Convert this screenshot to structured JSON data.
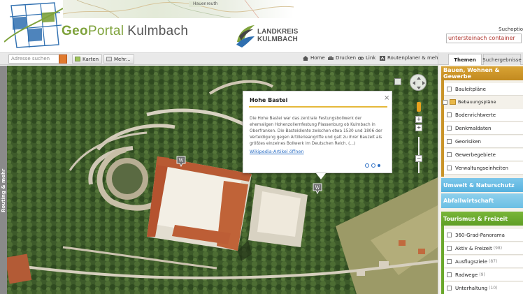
{
  "header": {
    "brand_geo": "Geo",
    "brand_portal": "Portal",
    "brand_place": "Kulmbach",
    "landkreis_line1": "LANDKREIS",
    "landkreis_line2": "KULMBACH",
    "search_options_label": "Suchoptio",
    "search_value": "untersteinach container",
    "map_place_label": "Hauenreuth"
  },
  "toolbar": {
    "address_placeholder": "Adresse suchen",
    "karten_label": "Karten",
    "mehr_label": "Mehr...",
    "home_label": "Home",
    "drucken_label": "Drucken",
    "link_label": "Link",
    "routenplaner_label": "Routenplaner & mehr"
  },
  "left_strip": {
    "label": "Routing & mehr"
  },
  "panel": {
    "tabs": [
      {
        "label": "Themen",
        "active": true
      },
      {
        "label": "Suchergebnisse",
        "active": false
      }
    ],
    "sections": {
      "bauen": "Bauen, Wohnen & Gewerbe",
      "umwelt": "Umwelt & Naturschutz",
      "abfall": "Abfallwirtschaft",
      "tourismus": "Tourismus & Freizeit"
    },
    "bauen_items": [
      {
        "label": "Bauleitpläne"
      },
      {
        "label": "Bebauungspläne"
      },
      {
        "label": "Bodenrichtwerte"
      },
      {
        "label": "Denkmaldaten"
      },
      {
        "label": "Georisiken"
      },
      {
        "label": "Gewerbegebiete"
      },
      {
        "label": "Verwaltungseinheiten"
      }
    ],
    "tourismus_items": [
      {
        "label": "360-Grad-Panorama",
        "count": ""
      },
      {
        "label": "Aktiv & Freizeit",
        "count": "(98)"
      },
      {
        "label": "Ausflugsziele",
        "count": "(87)"
      },
      {
        "label": "Radwege",
        "count": "(9)"
      },
      {
        "label": "Unterhaltung",
        "count": "(10)"
      }
    ]
  },
  "popup": {
    "title": "Hohe Bastei",
    "text": "Die Hohe Bastei war das zentrale Festungsbollwerk der ehemaligen Hohenzollernfestung Plassenburg ob Kulmbach in Oberfranken. Die Basteidiente zwischen etwa 1530 und 1806 der Verteidigung gegen Artillerieangriffe und galt zu ihrer Bauzeit als größtes einzelnes Bollwerk im Deutschen Reich. (...)",
    "link": "Wikipedia-Artikel öffnen",
    "close": "×"
  },
  "map_markers": [
    "wikipedia-marker",
    "wikipedia-marker"
  ],
  "colors": {
    "brand_green": "#7ea23b",
    "bauen": "#c99429",
    "umwelt": "#5cb4e0",
    "tourismus": "#6aa82c",
    "accent_yellow": "#e5b83a"
  }
}
